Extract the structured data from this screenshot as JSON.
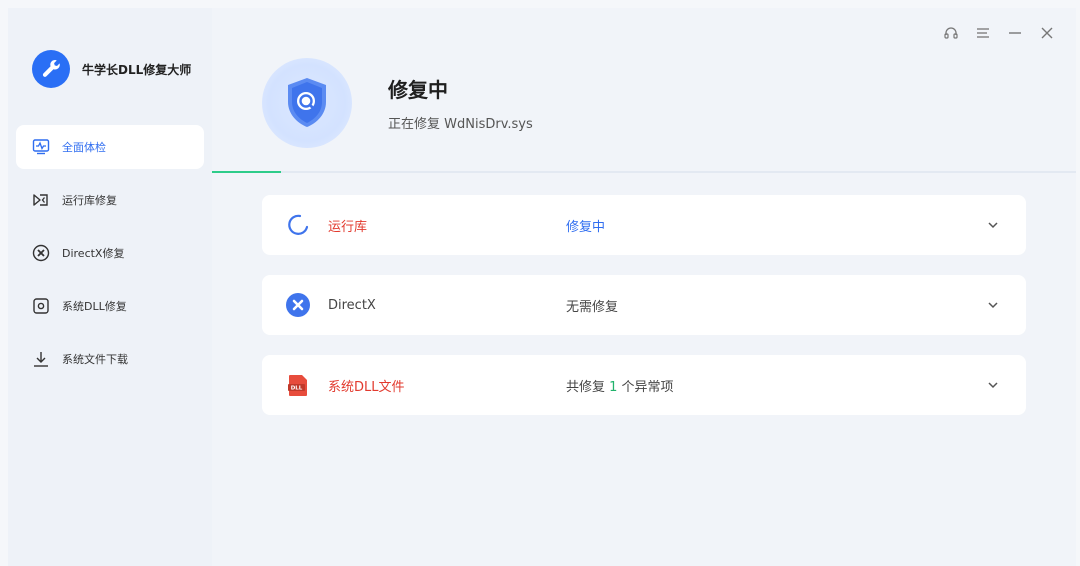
{
  "app": {
    "title": "牛学长DLL修复大师"
  },
  "sidebar": {
    "items": [
      {
        "label": "全面体检",
        "icon": "monitor-pulse-icon",
        "active": true
      },
      {
        "label": "运行库修复",
        "icon": "runtime-icon"
      },
      {
        "label": "DirectX修复",
        "icon": "directx-icon"
      },
      {
        "label": "系统DLL修复",
        "icon": "system-dll-icon"
      },
      {
        "label": "系统文件下载",
        "icon": "download-icon"
      }
    ]
  },
  "header": {
    "title": "修复中",
    "subtitle": "正在修复 WdNisDrv.sys"
  },
  "progress": {
    "value": 0.08
  },
  "cards": [
    {
      "name": "运行库",
      "status": "修复中",
      "icon": "loading-spinner-icon"
    },
    {
      "name": "DirectX",
      "status": "无需修复",
      "icon": "directx-x-icon"
    },
    {
      "name": "系统DLL文件",
      "status_prefix": "共修复 ",
      "status_count": "1",
      "status_suffix": " 个异常项",
      "icon": "dll-file-icon"
    }
  ],
  "colors": {
    "accent": "#2f6df0",
    "danger": "#e23a2e",
    "success": "#20b26b"
  }
}
